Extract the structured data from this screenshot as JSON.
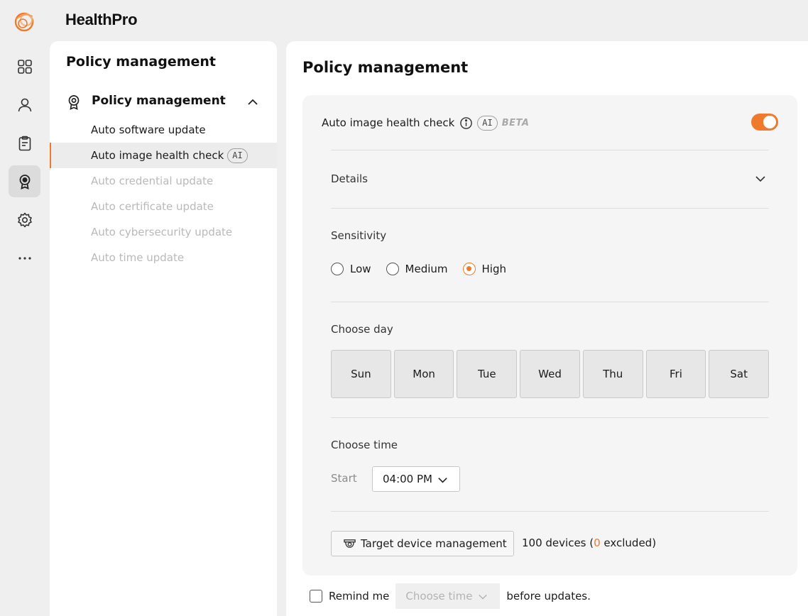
{
  "app": {
    "name": "HealthPro",
    "accent_color": "#f07a2b"
  },
  "rail": {
    "items": [
      {
        "icon": "dashboard-grid-icon"
      },
      {
        "icon": "user-icon"
      },
      {
        "icon": "clipboard-icon"
      },
      {
        "icon": "policy-badge-icon",
        "active": true
      },
      {
        "icon": "gear-icon"
      },
      {
        "icon": "more-dots-icon"
      }
    ]
  },
  "sidebar": {
    "title": "Policy management",
    "group": {
      "label": "Policy management",
      "icon": "policy-badge-icon",
      "expanded": true
    },
    "items": [
      {
        "label": "Auto software update",
        "state": "normal"
      },
      {
        "label": "Auto image health check",
        "badge": "AI",
        "state": "active"
      },
      {
        "label": "Auto credential update",
        "state": "disabled"
      },
      {
        "label": "Auto certificate update",
        "state": "disabled"
      },
      {
        "label": "Auto cybersecurity update",
        "state": "disabled"
      },
      {
        "label": "Auto time update",
        "state": "disabled"
      }
    ]
  },
  "main": {
    "title": "Policy management",
    "card": {
      "label": "Auto image health check",
      "ai_badge": "AI",
      "beta": "BETA",
      "enabled": true,
      "details_label": "Details",
      "sensitivity": {
        "label": "Sensitivity",
        "options": [
          "Low",
          "Medium",
          "High"
        ],
        "selected": "High"
      },
      "choose_day": {
        "label": "Choose day",
        "days": [
          "Sun",
          "Mon",
          "Tue",
          "Wed",
          "Thu",
          "Fri",
          "Sat"
        ]
      },
      "choose_time": {
        "label": "Choose time",
        "start_label": "Start",
        "start_value": "04:00 PM"
      },
      "target": {
        "button_label": "Target device management",
        "devices_prefix": "100 devices (",
        "excluded_count": "0",
        "devices_suffix": " excluded)"
      }
    },
    "remind": {
      "label": "Remind me",
      "checked": false,
      "placeholder": "Choose time",
      "suffix": "before updates."
    }
  }
}
